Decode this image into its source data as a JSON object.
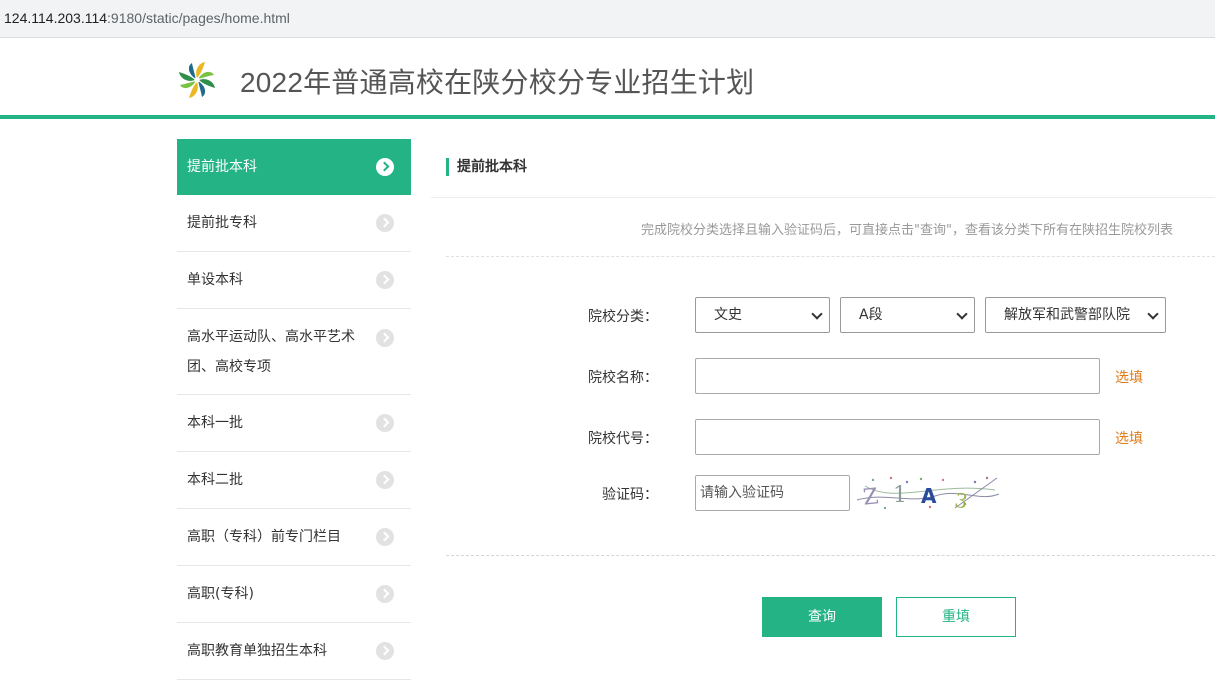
{
  "browser": {
    "url_host": "124.114.203.114",
    "url_rest": ":9180/static/pages/home.html"
  },
  "header": {
    "title": "2022年普通高校在陕分校分专业招生计划",
    "logo": "pinwheel-logo-icon",
    "accent": "#23b384"
  },
  "sidebar": {
    "items": [
      {
        "label": "提前批本科",
        "active": true
      },
      {
        "label": "提前批专科"
      },
      {
        "label": "单设本科"
      },
      {
        "label": "高水平运动队、高水平艺术团、高校专项"
      },
      {
        "label": "本科一批"
      },
      {
        "label": "本科二批"
      },
      {
        "label": "高职（专科）前专门栏目"
      },
      {
        "label": "高职(专科)"
      },
      {
        "label": "高职教育单独招生本科"
      }
    ],
    "item_icon": "chevron-right-circle-icon"
  },
  "main": {
    "title": "提前批本科",
    "hint": "完成院校分类选择且输入验证码后，可直接点击\"查询\"，查看该分类下所有在陕招生院校列表",
    "form": {
      "category_label": "院校分类：",
      "category_selects": [
        "文史",
        "A段",
        "解放军和武警部队院"
      ],
      "name_label": "院校名称：",
      "name_value": "",
      "name_optional": "选填",
      "code_label": "院校代号：",
      "code_value": "",
      "code_optional": "选填",
      "captcha_label": "验证码：",
      "captcha_placeholder": "请输入验证码",
      "captcha_text": "Z1A3"
    },
    "buttons": {
      "query": "查询",
      "reset": "重填"
    }
  }
}
